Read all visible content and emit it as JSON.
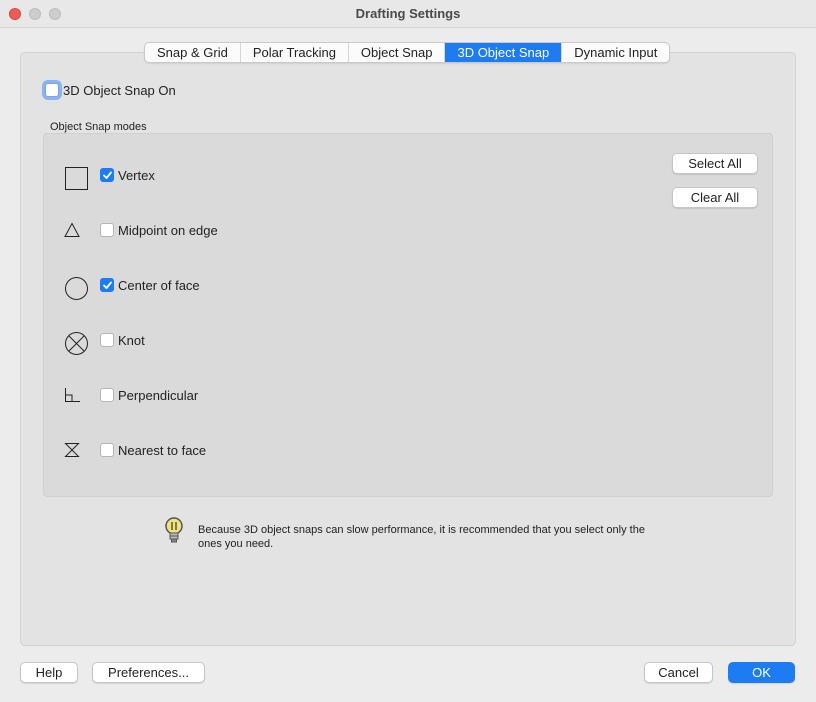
{
  "window": {
    "title": "Drafting Settings"
  },
  "tabs": [
    {
      "label": "Snap & Grid",
      "active": false
    },
    {
      "label": "Polar Tracking",
      "active": false
    },
    {
      "label": "Object Snap",
      "active": false
    },
    {
      "label": "3D Object Snap",
      "active": true
    },
    {
      "label": "Dynamic Input",
      "active": false
    }
  ],
  "snap_on": {
    "label": "3D Object Snap On",
    "checked": false
  },
  "group": {
    "title": "Object Snap modes",
    "modes": [
      {
        "label": "Vertex",
        "checked": true,
        "icon": "vertex-square-icon"
      },
      {
        "label": "Midpoint on edge",
        "checked": false,
        "icon": "midpoint-triangle-icon"
      },
      {
        "label": "Center of face",
        "checked": true,
        "icon": "center-circle-icon"
      },
      {
        "label": "Knot",
        "checked": false,
        "icon": "knot-circle-x-icon"
      },
      {
        "label": "Perpendicular",
        "checked": false,
        "icon": "perpendicular-icon"
      },
      {
        "label": "Nearest to face",
        "checked": false,
        "icon": "nearest-hourglass-icon"
      }
    ],
    "select_all": "Select All",
    "clear_all": "Clear All"
  },
  "note": {
    "icon": "lightbulb-icon",
    "text": "Because 3D object snaps can slow performance, it is recommended that you select only the ones you need."
  },
  "footer": {
    "help": "Help",
    "preferences": "Preferences...",
    "cancel": "Cancel",
    "ok": "OK"
  },
  "colors": {
    "accent": "#1e7cf2",
    "close": "#ee5d55"
  }
}
